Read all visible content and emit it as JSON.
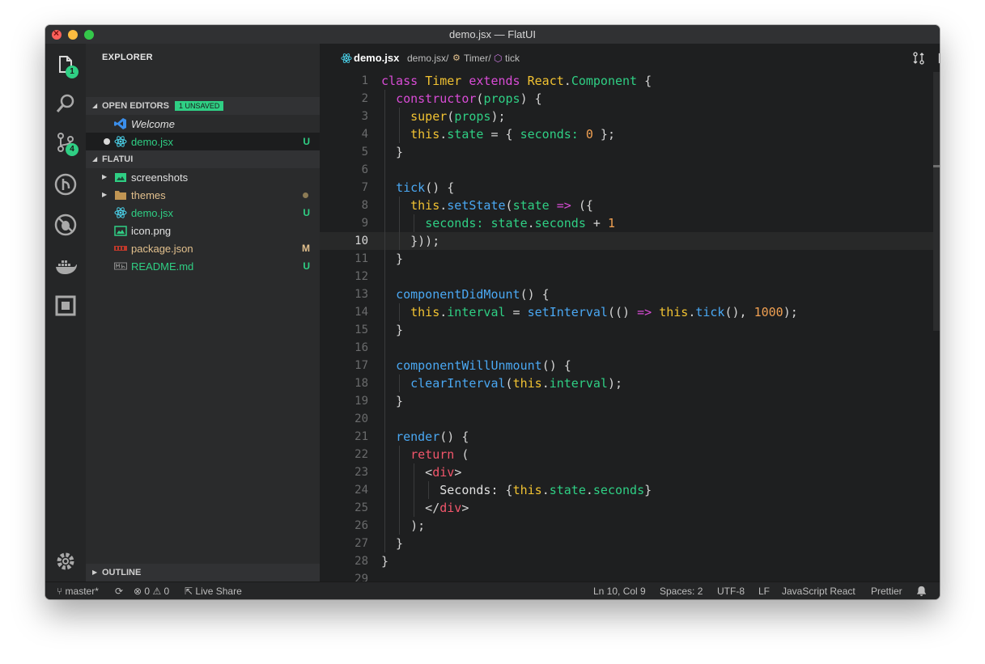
{
  "window": {
    "title": "demo.jsx — FlatUI"
  },
  "activity": {
    "explorer_badge": "1",
    "scm_badge": "4"
  },
  "sidebar": {
    "title": "EXPLORER",
    "open_editors": {
      "label": "OPEN EDITORS",
      "badge": "1 UNSAVED",
      "items": [
        {
          "name": "Welcome",
          "status": ""
        },
        {
          "name": "demo.jsx",
          "status": "U"
        }
      ]
    },
    "project": {
      "label": "FLATUI",
      "items": [
        {
          "name": "screenshots",
          "status": ""
        },
        {
          "name": "themes",
          "status": ""
        },
        {
          "name": "demo.jsx",
          "status": "U"
        },
        {
          "name": "icon.png",
          "status": ""
        },
        {
          "name": "package.json",
          "status": "M"
        },
        {
          "name": "README.md",
          "status": "U"
        }
      ]
    },
    "outline": {
      "label": "OUTLINE"
    }
  },
  "editor": {
    "tab_title": "demo.jsx",
    "breadcrumb": [
      "demo.jsx/",
      "Timer/",
      "tick"
    ],
    "line_numbers": [
      "1",
      "2",
      "3",
      "4",
      "5",
      "6",
      "7",
      "8",
      "9",
      "10",
      "11",
      "12",
      "13",
      "14",
      "15",
      "16",
      "17",
      "18",
      "19",
      "20",
      "21",
      "22",
      "23",
      "24",
      "25",
      "26",
      "27",
      "28",
      "29"
    ],
    "current_line": 10
  },
  "status": {
    "branch": "master*",
    "errors": "0",
    "warnings": "0",
    "live_share": "Live Share",
    "position": "Ln 10, Col 9",
    "spaces": "Spaces: 2",
    "encoding": "UTF-8",
    "eol": "LF",
    "language": "JavaScript React",
    "formatter": "Prettier"
  },
  "colors": {
    "accent": "#2fcf84",
    "keyword": "#d94cd6",
    "class": "#f1c232",
    "function": "#4aa8f3",
    "number": "#f0a052",
    "tag": "#f2566b"
  },
  "icons": [
    "files-icon",
    "search-icon",
    "source-control-icon",
    "git-branch-icon",
    "debug-icon",
    "docker-icon",
    "extensions-icon",
    "gear-icon",
    "react-icon",
    "folder-icon",
    "image-icon",
    "npm-icon",
    "markdown-icon",
    "vscode-icon",
    "compare-icon",
    "split-editor-icon",
    "bell-icon",
    "sync-icon",
    "error-icon",
    "warning-icon",
    "share-icon"
  ]
}
